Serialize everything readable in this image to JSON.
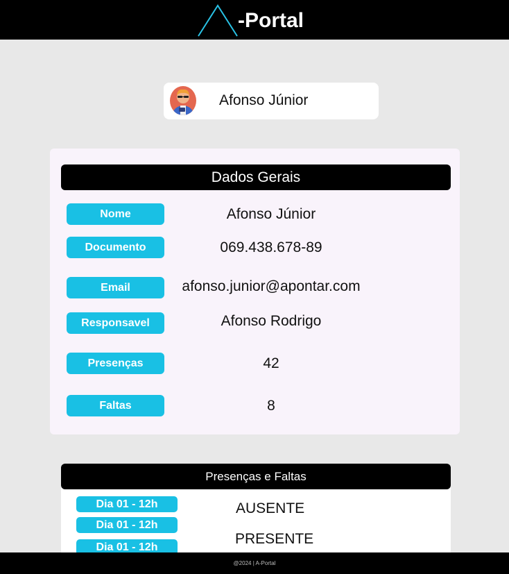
{
  "header": {
    "brand": "-Portal"
  },
  "profile": {
    "name": "Afonso Júnior"
  },
  "general": {
    "title": "Dados Gerais",
    "fields": [
      {
        "label": "Nome",
        "value": "Afonso Júnior"
      },
      {
        "label": "Documento",
        "value": "069.438.678-89"
      },
      {
        "label": "Email",
        "value": "afonso.junior@apontar.com"
      },
      {
        "label": "Responsavel",
        "value": "Afonso Rodrigo"
      },
      {
        "label": "Presenças",
        "value": "42"
      },
      {
        "label": "Faltas",
        "value": "8"
      }
    ]
  },
  "attendance": {
    "title": "Presenças e Faltas",
    "rows": [
      {
        "label": "Dia 01 - 12h",
        "status": "AUSENTE"
      },
      {
        "label": "Dia 01 - 12h",
        "status": "PRESENTE"
      },
      {
        "label": "Dia 01 - 12h",
        "status": ""
      }
    ]
  },
  "footer": {
    "text": "@2024 | A-Portal"
  },
  "colors": {
    "accent": "#19c0e4",
    "logo_line": "#29c3e6",
    "header_bg": "#000000",
    "page_bg": "#e8e8e8",
    "panel_bg": "#f9f3fb"
  },
  "icons": {
    "logo": "triangle-logo-icon",
    "avatar": "user-avatar-icon"
  }
}
